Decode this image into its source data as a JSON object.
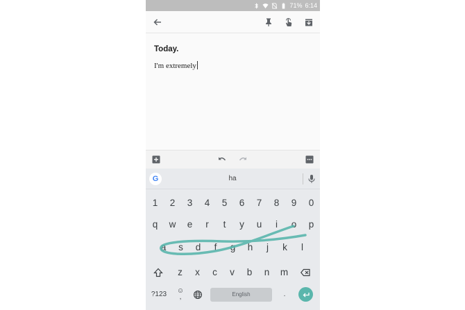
{
  "status_bar": {
    "battery_percent": "71%",
    "time": "6:14",
    "icons": [
      "bluetooth-icon",
      "wifi-icon",
      "no-sim-icon",
      "battery-icon"
    ]
  },
  "toolbar": {
    "icons": [
      "back-arrow-icon",
      "pin-icon",
      "reminder-hand-icon",
      "archive-icon"
    ]
  },
  "note": {
    "title": "Today.",
    "body": "I'm extremely"
  },
  "edit_bar": {
    "icons": [
      "add-box-icon",
      "undo-icon",
      "redo-icon",
      "more-icon"
    ]
  },
  "keyboard": {
    "suggestion": "ha",
    "google_label": "G",
    "number_row": [
      "1",
      "2",
      "3",
      "4",
      "5",
      "6",
      "7",
      "8",
      "9",
      "0"
    ],
    "row1": [
      "q",
      "w",
      "e",
      "r",
      "t",
      "y",
      "u",
      "i",
      "o",
      "p"
    ],
    "row2": [
      "a",
      "s",
      "d",
      "f",
      "g",
      "h",
      "j",
      "k",
      "l"
    ],
    "row3": [
      "z",
      "x",
      "c",
      "v",
      "b",
      "n",
      "m"
    ],
    "symbols_label": "?123",
    "emoji_label": "☺",
    "comma_label": ",",
    "space_label": "English",
    "period_label": ".",
    "swipe_trail_color": "#5ab6ac",
    "accent_color": "#5ab6ac"
  }
}
